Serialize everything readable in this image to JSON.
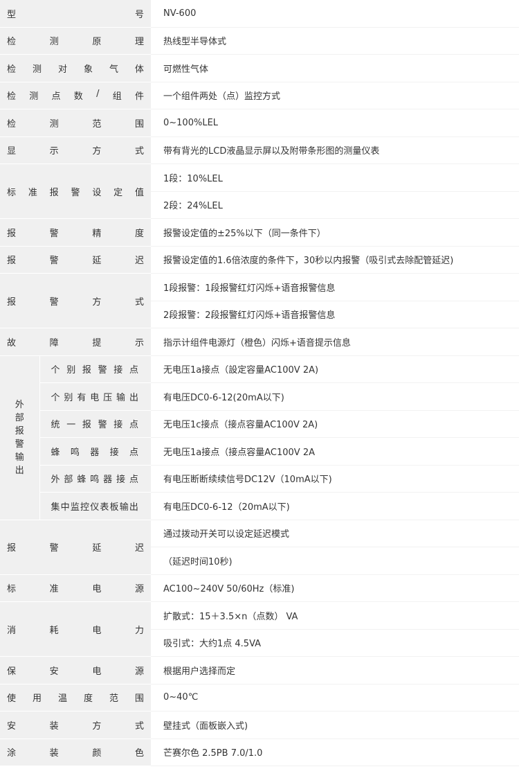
{
  "rows": [
    {
      "label": "型号",
      "values": [
        "NV-600"
      ]
    },
    {
      "label": "检测原理",
      "values": [
        "热线型半导体式"
      ]
    },
    {
      "label": "检测对象气体",
      "values": [
        "可燃性气体"
      ]
    },
    {
      "label": "检测点数/组件",
      "values": [
        "一个组件两处（点）监控方式"
      ]
    },
    {
      "label": "检测范围",
      "values": [
        "0~100%LEL"
      ]
    },
    {
      "label": "显示方式",
      "values": [
        "带有背光的LCD液晶显示屏以及附带条形图的测量仪表"
      ]
    },
    {
      "label": "标准报警设定值",
      "values": [
        "1段：10%LEL",
        "2段：24%LEL"
      ]
    },
    {
      "label": "报警精度",
      "values": [
        "报警设定值的±25%以下（同一条件下）"
      ]
    },
    {
      "label": "报警延迟",
      "values": [
        "报警设定值的1.6倍浓度的条件下，30秒以内报警（吸引式去除配管延迟)"
      ]
    },
    {
      "label": "报警方式",
      "values": [
        "1段报警：1段报警红灯闪烁+语音报警信息",
        "2段报警：2段报警红灯闪烁+语音报警信息"
      ]
    },
    {
      "label": "故障提示",
      "values": [
        "指示计组件电源灯（橙色）闪烁+语音提示信息"
      ]
    }
  ],
  "output_group": {
    "label": "外部报警输出",
    "items": [
      {
        "label": "个别报警接点",
        "value": "无电压1a接点（設定容量AC100V 2A)"
      },
      {
        "label": "个别有电压输出",
        "value": "有电压DC0-6-12(20mA以下)"
      },
      {
        "label": "统一报警接点",
        "value": "无电压1c接点（接点容量AC100V 2A)"
      },
      {
        "label": "蜂鸣器接点",
        "value": "无电压1a接点（接点容量AC100V 2A"
      },
      {
        "label": "外部蜂鸣器接点",
        "value": "有电压断断续续信号DC12V（10mA以下)"
      },
      {
        "label": "集中监控仪表板输出",
        "value": "有电压DC0-6-12（20mA以下)"
      }
    ]
  },
  "rows2": [
    {
      "label": "报警延迟",
      "values": [
        "通过拨动开关可以设定延迟模式",
        "（延迟时间10秒)"
      ]
    },
    {
      "label": "标准电源",
      "values": [
        "AC100~240V  50/60Hz（标准)"
      ]
    },
    {
      "label": "消耗电力",
      "values": [
        "扩散式：15＋3.5×n（点数）  VA",
        "吸引式：大约1点 4.5VA"
      ]
    },
    {
      "label": "保安电源",
      "values": [
        "根据用户选择而定"
      ]
    },
    {
      "label": "使用温度范围",
      "values": [
        "0~40℃"
      ]
    },
    {
      "label": "安装方式",
      "values": [
        "壁挂式（面板嵌入式)"
      ]
    },
    {
      "label": "涂装颜色",
      "values": [
        "芒赛尔色 2.5PB 7.0/1.0"
      ]
    }
  ]
}
